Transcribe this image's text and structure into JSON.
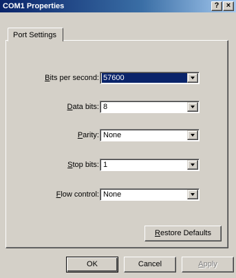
{
  "window": {
    "title": "COM1 Properties"
  },
  "titlebar": {
    "help_label": "?",
    "close_label": "×"
  },
  "tabs": [
    {
      "label": "Port Settings"
    }
  ],
  "fields": [
    {
      "label_key": "B",
      "label_rest": "its per second:",
      "value": "57600",
      "selected": true
    },
    {
      "label_key": "D",
      "label_rest": "ata bits:",
      "value": "8"
    },
    {
      "label_key": "P",
      "label_rest": "arity:",
      "value": "None"
    },
    {
      "label_key": "S",
      "label_rest": "top bits:",
      "value": "1"
    },
    {
      "label_key": "F",
      "label_rest": "low control:",
      "value": "None"
    }
  ],
  "restore": {
    "key": "R",
    "rest": "estore Defaults"
  },
  "footer": {
    "ok_label": "OK",
    "cancel_label": "Cancel",
    "apply_key": "A",
    "apply_rest": "pply"
  },
  "colors": {
    "title_start": "#0a246a",
    "title_end": "#a6caf0",
    "face": "#d4d0c8",
    "selection": "#0a246a"
  }
}
